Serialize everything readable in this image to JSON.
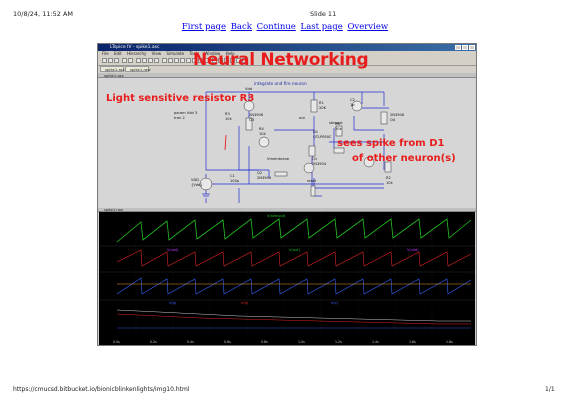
{
  "print_header": {
    "datetime": "10/8/24, 11:52 AM",
    "slide_title": "Slide 11"
  },
  "nav": {
    "first": "First page",
    "back": "Back",
    "continue": "Continue",
    "last": "Last page",
    "overview": "Overview"
  },
  "print_footer": {
    "url": "https://cmucsd.bitbucket.io/bionicblinkenlights/img10.html",
    "page": "1/1"
  },
  "app": {
    "title": "LTspice IV - spike1.asc",
    "menu": [
      "File",
      "Edit",
      "Hierarchy",
      "View",
      "Simulate",
      "Tools",
      "Window",
      "Help"
    ],
    "tabs": [
      "spike1.asc",
      "spike1.raw"
    ],
    "schematic_tab": "spike1.asc",
    "waveform_tab": "spike1.raw"
  },
  "schematic": {
    "title": "integrate and fire neuron",
    "labels": {
      "vdd": "Vdd",
      "r1": "R1",
      "r1v": "20K",
      "c2": "C2",
      "c2v": "1p",
      "q5": "2N3906",
      "q4": "Q4",
      "q3": "2N3906",
      "q3b": "Q3",
      "out": "out",
      "r3": "R3",
      "r3v": "10k",
      "param": "param Vdd 3",
      "tran": "tran 2",
      "r4": "R4",
      "r4v": "10k",
      "d1": "D1",
      "d1v": "QTLP650C",
      "r5": "R5",
      "r5v": "20k",
      "stimout": "stimout",
      "vmem": "Vmembrane",
      "q1": "Q1",
      "q1v": "2N3904",
      "q2": "Q2",
      "q2v": "2N3904",
      "c1": "C1",
      "c1v": "100p",
      "reset": "reset",
      "r2": "R2",
      "r2v": "10k",
      "vdd_src": "VDD",
      "vdd_val": "{Vdd}"
    }
  },
  "waveform": {
    "top_trace": "V(stimout)",
    "mid1": "V(vdd)",
    "mid2": "V(out)",
    "mid3": "V(vdd)",
    "bot1": "V(a)",
    "bot2": "V(b)",
    "bot3": "V(c)",
    "x_ticks": [
      "0.0s",
      "0.2s",
      "0.4s",
      "0.6s",
      "0.8s",
      "1.0s",
      "1.2s",
      "1.4s",
      "1.6s",
      "1.8s"
    ]
  },
  "annotations": {
    "headline": "Neural Networking",
    "resistor": "Light sensitive resistor R3",
    "spike1": "sees spike from D1",
    "spike2": "of other neuron(s)"
  },
  "colors": {
    "annotation": "#e81c1c",
    "link": "#0000ee",
    "trace_green": "#22c322",
    "trace_red": "#e02424",
    "trace_blue": "#3a64ff"
  }
}
